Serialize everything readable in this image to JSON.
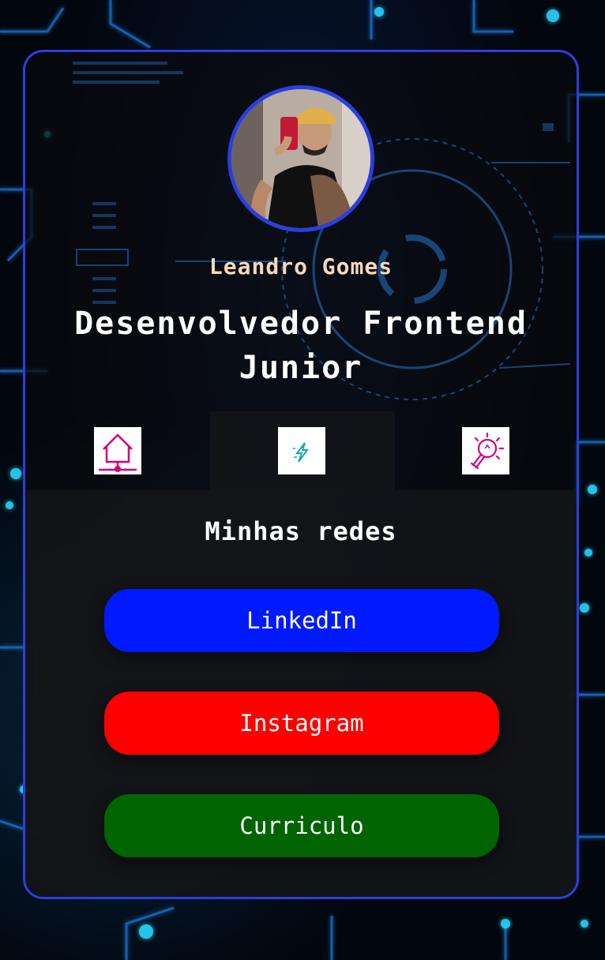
{
  "profile": {
    "name": "Leandro Gomes",
    "title": "Desenvolvedor Frontend Junior"
  },
  "tabs": [
    {
      "icon": "home-network-icon",
      "active": false
    },
    {
      "icon": "lightning-icon",
      "active": true
    },
    {
      "icon": "lightbulb-icon",
      "active": false
    }
  ],
  "section": {
    "title": "Minhas redes"
  },
  "links": [
    {
      "label": "LinkedIn",
      "color": "#0019ff"
    },
    {
      "label": "Instagram",
      "color": "#ff0000"
    },
    {
      "label": "Curriculo",
      "color": "#006400"
    }
  ],
  "colors": {
    "accent_border": "#2a3fe0",
    "name_text": "#f7d7b7",
    "icon_magenta": "#d4007a",
    "icon_teal": "#1aa7a7"
  }
}
